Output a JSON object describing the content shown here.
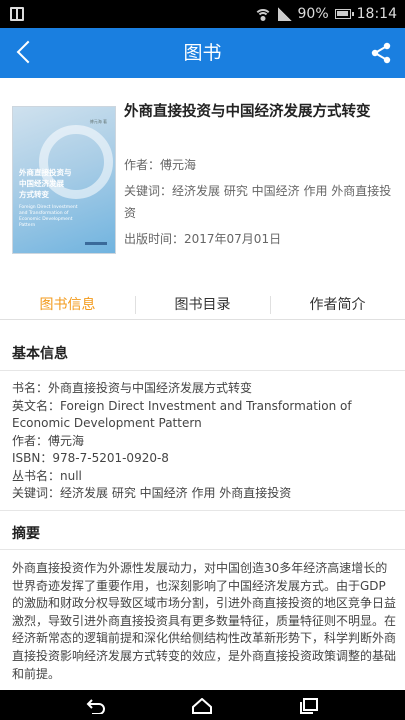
{
  "status": {
    "battery_pct": "90%",
    "time": "18:14",
    "icons": [
      "screen-icon",
      "wifi-icon",
      "signal-icon",
      "battery-icon"
    ]
  },
  "appbar": {
    "title": "图书",
    "back_icon": "chevron-left-icon",
    "share_icon": "share-icon",
    "color": "#1a7fe0"
  },
  "book": {
    "title": "外商直接投资与中国经济发展方式转变",
    "author_line": "作者：傅元海",
    "keywords_line": "关键词：经济发展 研究 中国经济 作用 外商直接投资",
    "publish_line": "出版时间：2017年07月01日",
    "cover": {
      "title_line1": "外商直接投资与",
      "title_line2": "中国经济发展",
      "title_line3": "方式转变",
      "subtitle": "Foreign Direct Investment and Transformation of Economic Development Pattern",
      "author": "傅元海 著"
    }
  },
  "tabs": [
    {
      "label": "图书信息",
      "active": true
    },
    {
      "label": "图书目录",
      "active": false
    },
    {
      "label": "作者简介",
      "active": false
    }
  ],
  "accent_color": "#f39a1b",
  "basic_info": {
    "title": "基本信息",
    "rows": [
      "书名：外商直接投资与中国经济发展方式转变",
      "英文名：Foreign Direct Investment and Transformation of Economic Development Pattern",
      "作者：傅元海",
      "ISBN：978-7-5201-0920-8",
      "丛书名：null",
      "关键词：经济发展 研究 中国经济 作用 外商直接投资"
    ]
  },
  "abstract": {
    "title": "摘要",
    "text": "外商直接投资作为外源性发展动力，对中国创造30多年经济高速增长的世界奇迹发挥了重要作用，也深刻影响了中国经济发展方式。由于GDP的激励和财政分权导致区域市场分割，引进外商直接投资的地区竞争日益激烈，导致引进外商直接投资具有更多数量特征，质量特征则不明显。在经济新常态的逻辑前提和深化供给侧结构性改革新形势下，科学判断外商直接投资影响经济发展方式转变的效应，是外商直接投资政策调整的基础和前提。"
  },
  "navbar": {
    "icons": [
      "back-icon",
      "home-icon",
      "recent-apps-icon"
    ]
  }
}
